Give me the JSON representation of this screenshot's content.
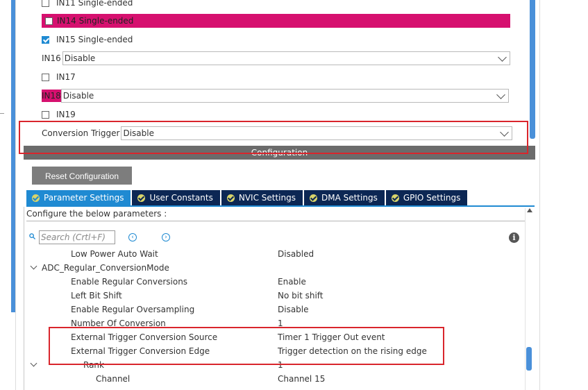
{
  "channels": {
    "in11_label": "IN11 Single-ended",
    "in14_label": "IN14 Single-ended",
    "in15_label": "IN15 Single-ended",
    "in16_label": "IN16",
    "in16_value": "Disable",
    "in17_label": "IN17",
    "in18_label": "IN18",
    "in18_value": "Disable",
    "in19_label": "IN19"
  },
  "conversion_trigger": {
    "label": "Conversion Trigger",
    "value": "Disable"
  },
  "configuration_header": "Configuration",
  "reset_button": "Reset Configuration",
  "tabs": [
    {
      "label": "Parameter Settings",
      "active": true
    },
    {
      "label": "User Constants",
      "active": false
    },
    {
      "label": "NVIC Settings",
      "active": false
    },
    {
      "label": "DMA Settings",
      "active": false
    },
    {
      "label": "GPIO Settings",
      "active": false
    }
  ],
  "configure_text": "Configure the below parameters :",
  "search": {
    "placeholder": "Search (Crtl+F)"
  },
  "icons": {
    "nav_prev": "chevron-left-circle-icon",
    "nav_next": "chevron-right-circle-icon",
    "info": "info-icon",
    "search": "search-icon"
  },
  "params": [
    {
      "name": "Low Power Auto Wait",
      "value": "Disabled"
    },
    {
      "name": "ADC_Regular_ConversionMode",
      "value": ""
    },
    {
      "name": "Enable Regular Conversions",
      "value": "Enable"
    },
    {
      "name": "Left Bit Shift",
      "value": "No bit shift"
    },
    {
      "name": "Enable Regular Oversampling",
      "value": "Disable"
    },
    {
      "name": "Number Of Conversion",
      "value": "1"
    },
    {
      "name": "External Trigger Conversion Source",
      "value": "Timer 1 Trigger Out event"
    },
    {
      "name": "External Trigger Conversion Edge",
      "value": "Trigger detection on the rising edge"
    },
    {
      "name": "Rank",
      "value": "1"
    },
    {
      "name": "Channel",
      "value": "Channel 15"
    }
  ],
  "colors": {
    "accent_blue": "#1f8ad2",
    "tab_dark": "#0c2754",
    "highlight_pink": "#d6106f",
    "annotation_red": "#d9252c"
  }
}
